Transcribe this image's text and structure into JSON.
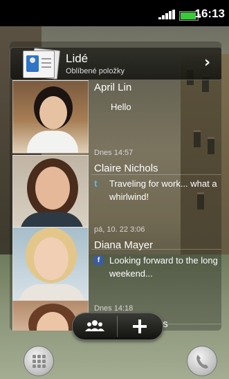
{
  "status_bar": {
    "time": "16:13",
    "battery_color": "#39c93a"
  },
  "widget": {
    "title": "Lidé",
    "subtitle": "Oblíbené položky",
    "app_icon": "contacts-card-icon",
    "nav_icon": "chevron-right-icon"
  },
  "contacts": [
    {
      "name": "April Lin",
      "time": "",
      "status": "Hello",
      "source_icon": ""
    },
    {
      "name": "Claire Nichols",
      "time": "Dnes 14:57",
      "status": "Traveling for work... what a whirlwind!",
      "source_icon": "twitter-icon"
    },
    {
      "name": "Diana Mayer",
      "time": "pá, 10. 22 3:06",
      "status": "Looking forward to the long weekend...",
      "source_icon": "facebook-icon"
    },
    {
      "name": "Jasmine Brooks",
      "time": "Dnes 14:18",
      "status": "",
      "source_icon": ""
    }
  ],
  "toolbar": {
    "group_icon": "people-group-icon",
    "add_icon": "plus-icon"
  },
  "home": {
    "apps_icon": "all-apps-grid-icon",
    "phone_icon": "phone-icon"
  }
}
